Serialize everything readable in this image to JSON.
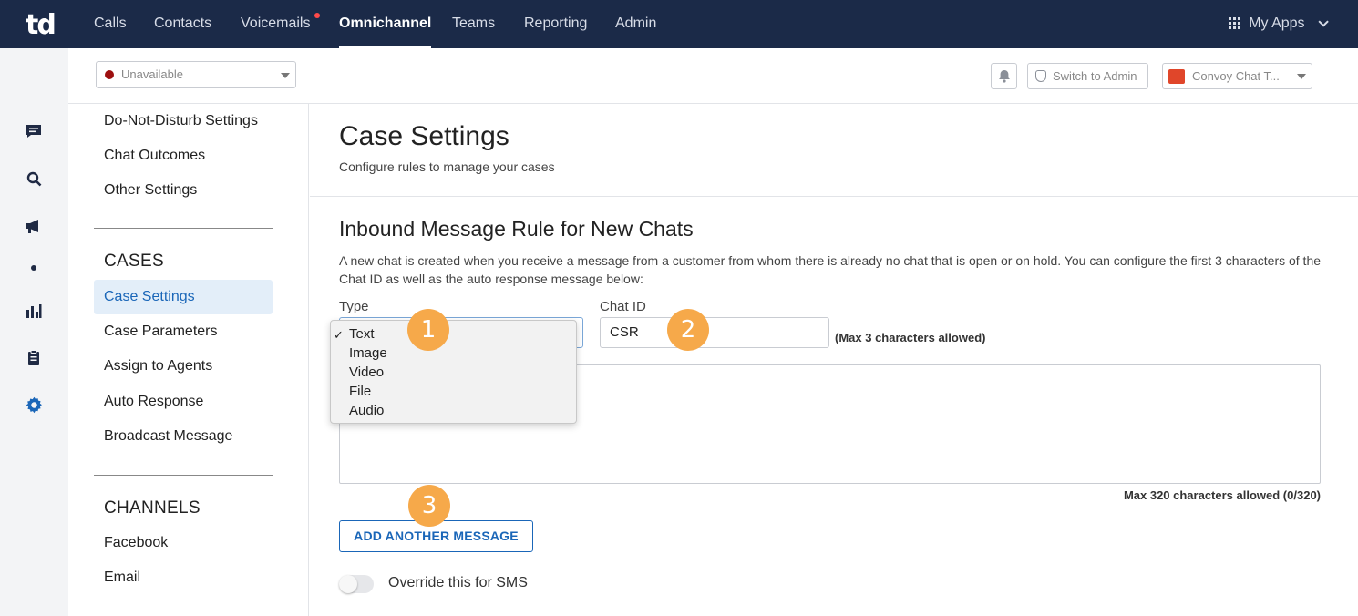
{
  "brand": {
    "logo": "td"
  },
  "nav": {
    "items": [
      {
        "label": "Calls"
      },
      {
        "label": "Contacts"
      },
      {
        "label": "Voicemails"
      },
      {
        "label": "Omnichannel"
      },
      {
        "label": "Teams"
      },
      {
        "label": "Reporting"
      },
      {
        "label": "Admin"
      }
    ],
    "active": "Omnichannel",
    "my_apps": "My Apps"
  },
  "rail": {
    "icons": [
      "chat-icon",
      "search-icon",
      "megaphone-icon",
      "dot-icon",
      "bar-chart-icon",
      "clipboard-icon",
      "gear-icon"
    ],
    "active_icon": "gear-icon"
  },
  "subheader": {
    "status": "Unavailable",
    "switch_label": "Switch to Admin",
    "account": "Convoy Chat T..."
  },
  "sidebar": {
    "top_items": [
      "Do-Not-Disturb Settings",
      "Chat Outcomes",
      "Other Settings"
    ],
    "cases_heading": "CASES",
    "cases_items": [
      "Case Settings",
      "Case Parameters",
      "Assign to Agents",
      "Auto Response",
      "Broadcast Message"
    ],
    "active": "Case Settings",
    "channels_heading": "CHANNELS",
    "channels_items": [
      "Facebook",
      "Email"
    ]
  },
  "main": {
    "title": "Case Settings",
    "subtitle": "Configure rules to manage your cases",
    "section_title": "Inbound Message Rule for New Chats",
    "description": "A new chat is created when you receive a message from a customer from whom there is already no chat that is open or on hold. You can configure the first 3 characters of the Chat ID as well as the auto response message below:",
    "type_label": "Type",
    "type_options": [
      "Text",
      "Image",
      "Video",
      "File",
      "Audio"
    ],
    "type_selected": "Text",
    "check_mark": "✓",
    "chat_id_label": "Chat ID",
    "chat_id_value": "CSR",
    "chat_id_hint": "(Max 3 characters allowed)",
    "message_value": "",
    "message_hint": "Max 320 characters allowed (0/320)",
    "add_button": "ADD ANOTHER MESSAGE",
    "override_label": "Override this for SMS",
    "override_on": false
  },
  "callouts": [
    "1",
    "2",
    "3"
  ],
  "colors": {
    "topbar": "#1b2a48",
    "accent": "#1a66b8",
    "callout": "#f6a94a",
    "status_dot": "#9d0f0f"
  }
}
